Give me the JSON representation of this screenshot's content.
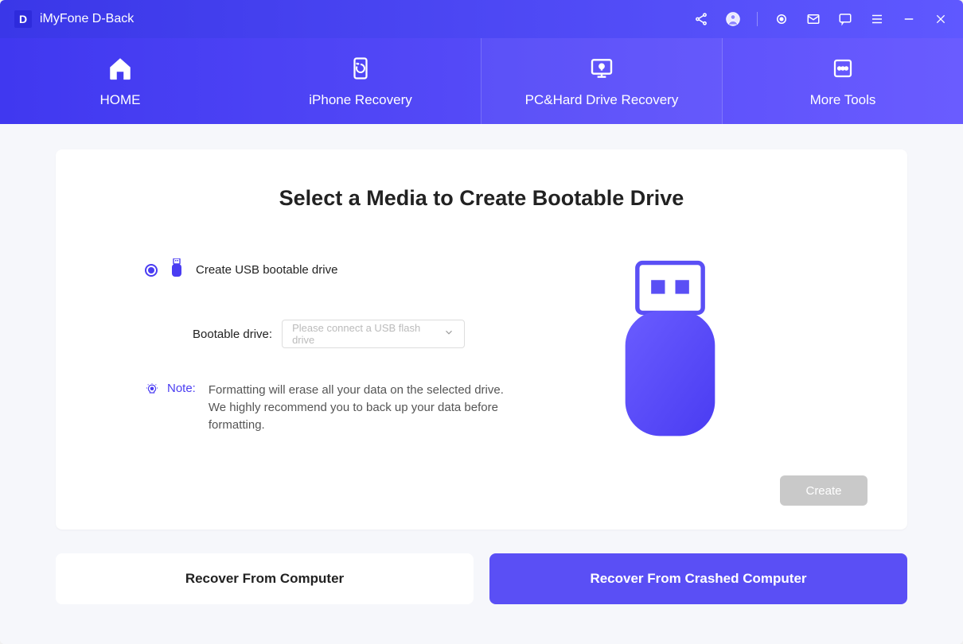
{
  "app": {
    "logo_letter": "D",
    "title": "iMyFone D-Back"
  },
  "titlebar_icons": {
    "share": "share-icon",
    "account": "account-icon",
    "settings": "settings-icon",
    "mail": "mail-icon",
    "message": "message-icon",
    "menu": "menu-icon",
    "minimize": "minimize-icon",
    "close": "close-icon"
  },
  "nav": [
    {
      "label": "HOME",
      "icon": "home-icon"
    },
    {
      "label": "iPhone Recovery",
      "icon": "iphone-recovery-icon"
    },
    {
      "label": "PC&Hard Drive Recovery",
      "icon": "pc-recovery-icon",
      "active": true
    },
    {
      "label": "More Tools",
      "icon": "more-tools-icon"
    }
  ],
  "card": {
    "title": "Select a Media to Create Bootable Drive",
    "option_label": "Create USB bootable drive",
    "drive_label": "Bootable drive:",
    "drive_placeholder": "Please connect a USB flash drive",
    "note_label": "Note:",
    "note_text": "Formatting will erase all your data on the selected drive. We highly recommend you to back up your data before formatting.",
    "create_button": "Create"
  },
  "bottom": {
    "recover_computer": "Recover From Computer",
    "recover_crashed": "Recover From Crashed Computer"
  }
}
